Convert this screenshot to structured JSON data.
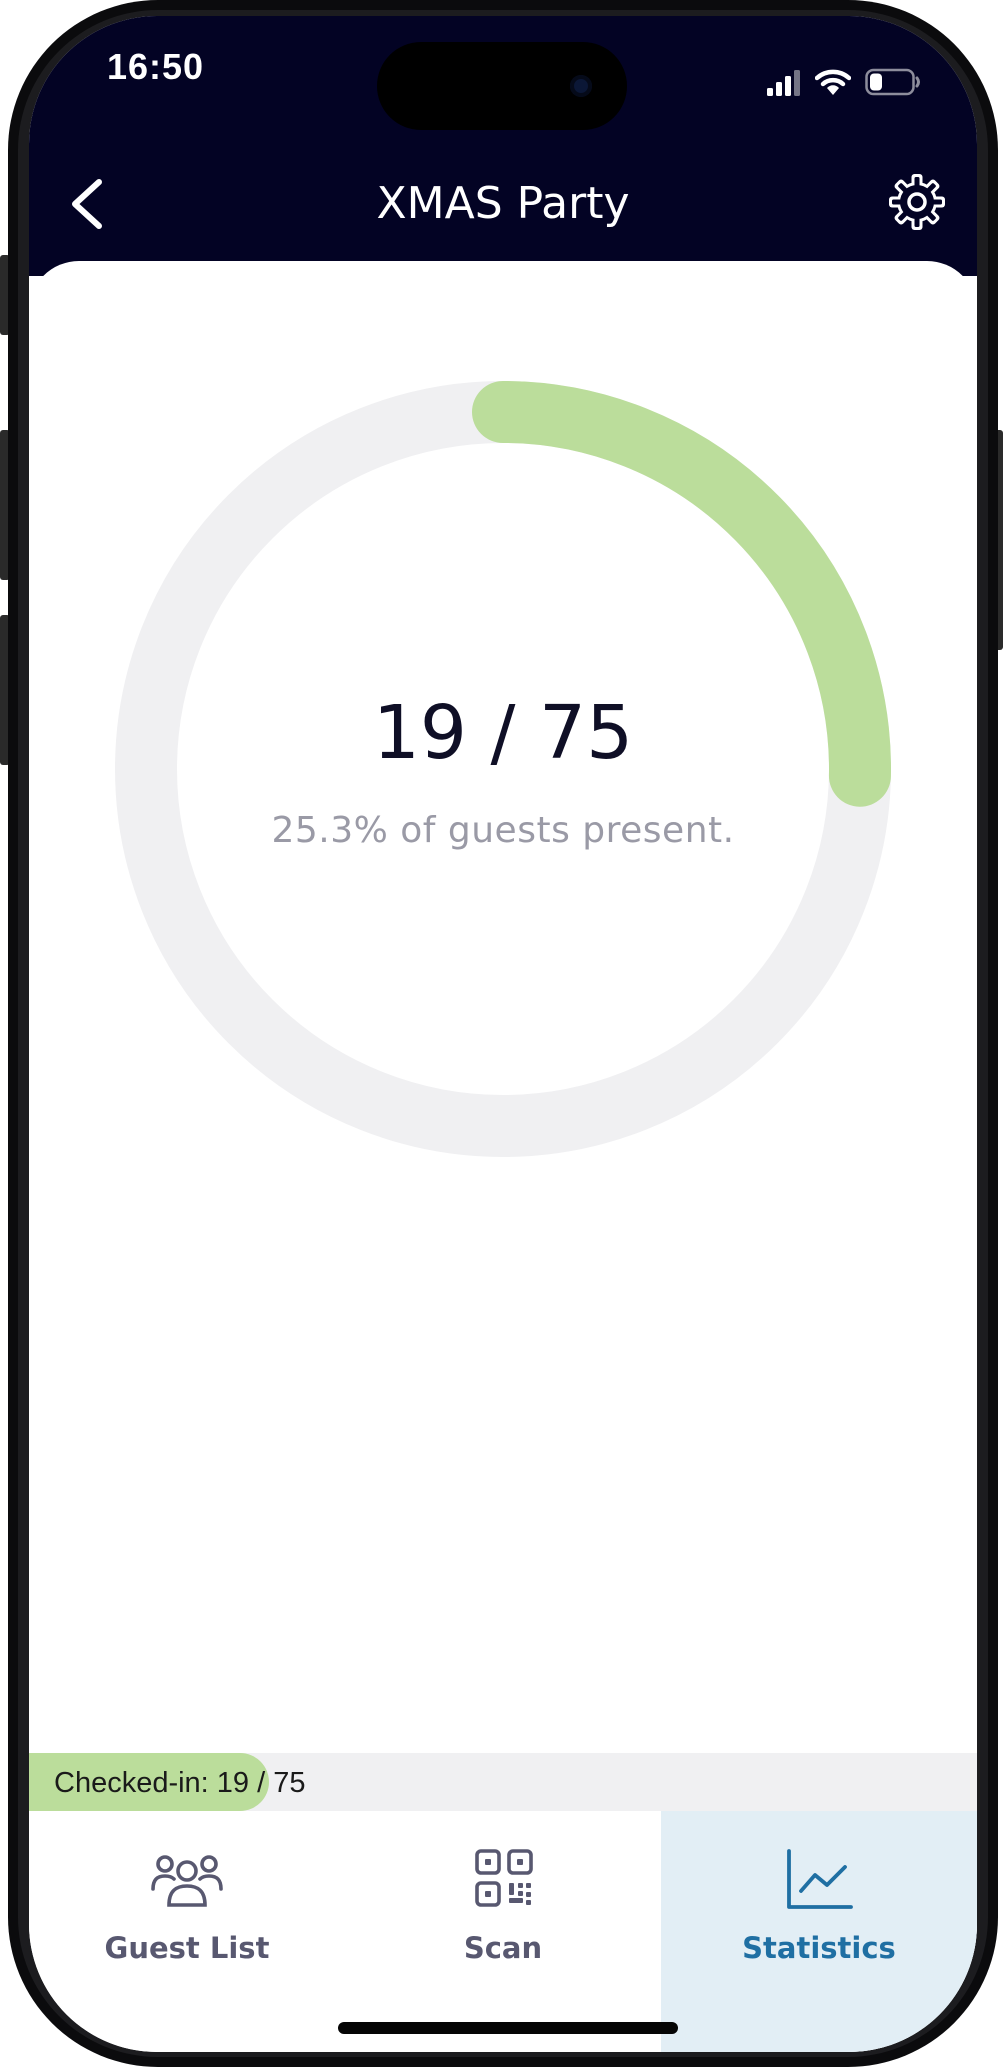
{
  "status_bar": {
    "time": "16:50"
  },
  "header": {
    "title": "XMAS Party"
  },
  "stats": {
    "checked_in": 19,
    "total": 75,
    "count_text": "19 / 75",
    "percent_text": "25.3% of guests present.",
    "fraction": 0.253
  },
  "progress": {
    "label": "Checked-in: 19 / 75",
    "fraction": 0.253
  },
  "tabs": [
    {
      "label": "Guest List",
      "icon": "users-icon",
      "active": false
    },
    {
      "label": "Scan",
      "icon": "qr-code-icon",
      "active": false
    },
    {
      "label": "Statistics",
      "icon": "chart-line-icon",
      "active": true
    }
  ],
  "colors": {
    "header_bg": "#030324",
    "ring_fill": "#bbdd9b",
    "ring_track": "#f0f0f2",
    "accent_blue": "#1f6fa3",
    "active_tab_bg": "#e2eef5"
  }
}
